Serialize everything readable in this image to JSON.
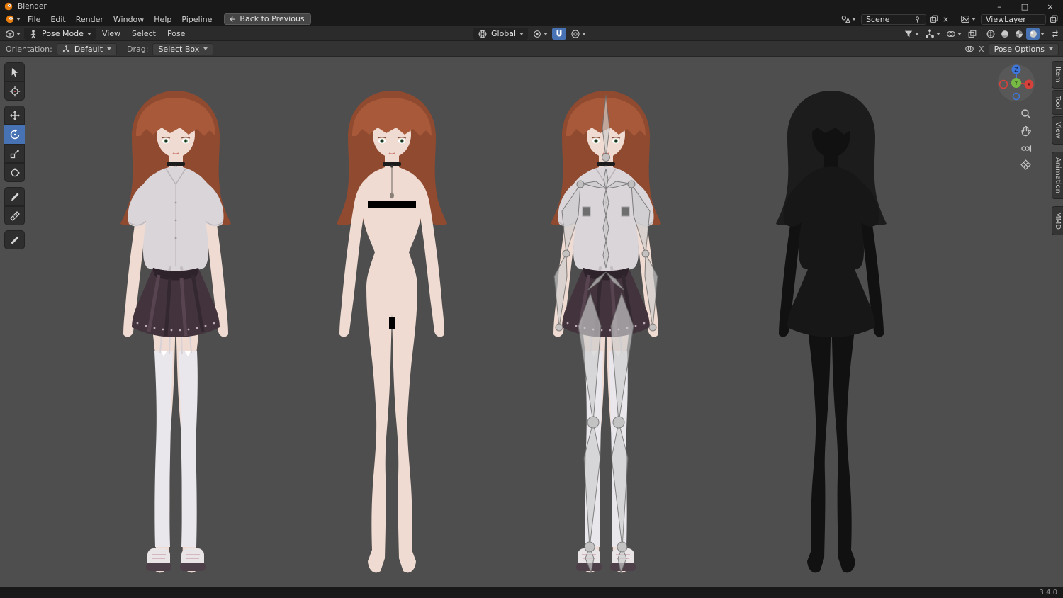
{
  "window": {
    "title": "Blender",
    "controls": {
      "minimize": "–",
      "maximize": "□",
      "close": "×"
    }
  },
  "menubar": {
    "menus": [
      "File",
      "Edit",
      "Render",
      "Window",
      "Help",
      "Pipeline"
    ],
    "back_button": "Back to Previous"
  },
  "scene_bar": {
    "scene": "Scene",
    "view_layer": "ViewLayer"
  },
  "viewport_header": {
    "mode": "Pose Mode",
    "menus": [
      "View",
      "Select",
      "Pose"
    ],
    "orientation": "Global"
  },
  "tool_settings": {
    "orientation_label": "Orientation:",
    "orientation_value": "Default",
    "drag_label": "Drag:",
    "drag_value": "Select Box",
    "mirror_label": "X",
    "pose_options_label": "Pose Options"
  },
  "left_toolbar": {
    "tools": [
      "tweak-select",
      "cursor-3d",
      "move",
      "rotate",
      "scale",
      "transform",
      "annotate",
      "measure",
      "pose-breakdowner"
    ],
    "active_tool": "rotate"
  },
  "sidebar_tabs": [
    "Item",
    "Tool",
    "View",
    "Animation",
    "MMD"
  ],
  "nav_gizmo": {
    "axes": [
      {
        "label": "Z",
        "color": "#3f76d8"
      },
      {
        "label": "Y",
        "color": "#76b944"
      },
      {
        "label": "X",
        "color": "#d6413c"
      }
    ]
  },
  "statusbar": {
    "version": "3.4.0"
  },
  "colors": {
    "accent": "#4772b3",
    "viewport_bg": "#4e4e4e",
    "skin": "#efdbd2",
    "hair": "#a8593a",
    "hair_dark": "#8f4a30",
    "shirt": "#dad5d9",
    "skirt": "#43333c",
    "stockings": "#eae7ec",
    "censor": "#000000",
    "wireframe": "#111111",
    "wireframe_hair": "#1c1c1c",
    "wireframe_cloth": "#171717"
  }
}
